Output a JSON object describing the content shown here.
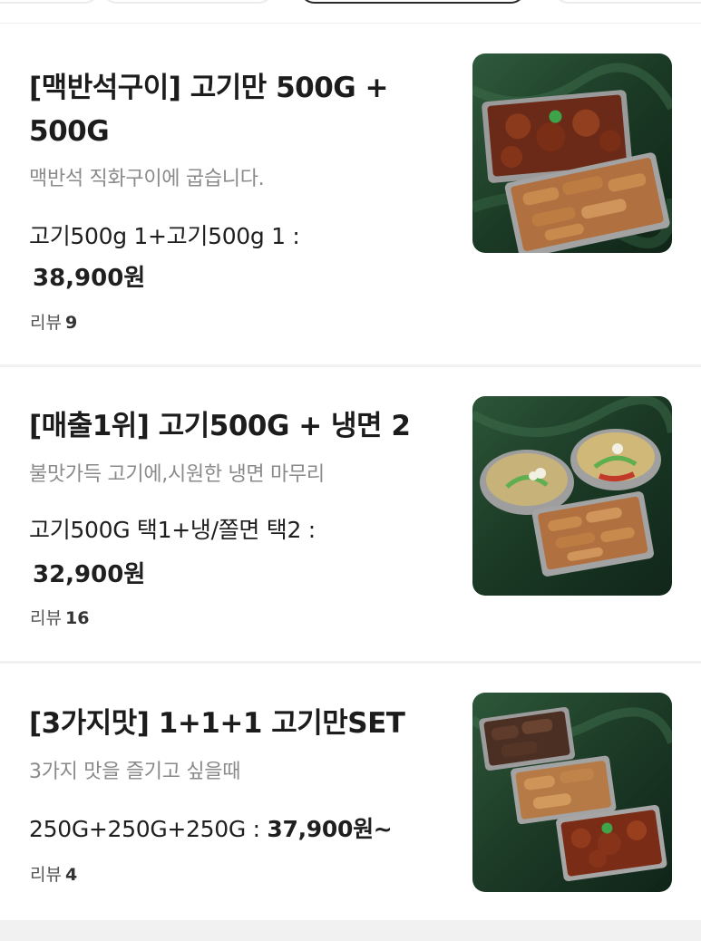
{
  "colors": {
    "title": "#1c1c1c",
    "description": "#8a8a8a",
    "separator": "#f1f1f1",
    "thumb_background": "#1f3d2a"
  },
  "menu_items": [
    {
      "title_line1": "[맥반석구이] 고기만 500G +",
      "title_line2": "500G",
      "description": "맥반석 직화구이에 굽습니다.",
      "option": "고기500g 1+고기500g 1 :",
      "price": "38,900원",
      "review_label": "리뷰",
      "review_count": "9",
      "image_icon": "food-photo-icon"
    },
    {
      "title_line1": "[매출1위] 고기500G + 냉면 2",
      "description": "불맛가득 고기에,시원한 냉면 마무리",
      "option": "고기500G 택1+냉/쫄면 택2 :",
      "price": "32,900원",
      "review_label": "리뷰",
      "review_count": "16",
      "image_icon": "food-photo-icon"
    },
    {
      "title_line1": "[3가지맛] 1+1+1 고기만SET",
      "description": "3가지 맛을 즐기고 싶을때",
      "option": "250G+250G+250G :",
      "price": "37,900원~",
      "review_label": "리뷰",
      "review_count": "4",
      "image_icon": "food-photo-icon"
    }
  ]
}
